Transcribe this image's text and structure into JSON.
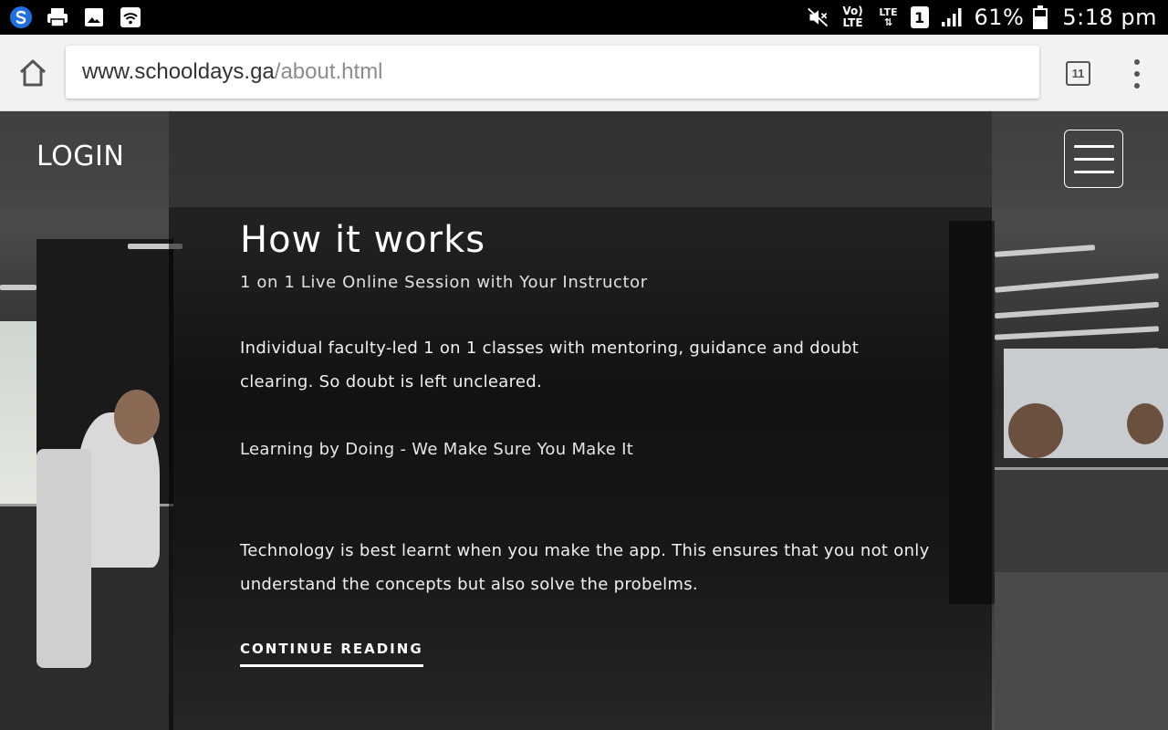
{
  "status_bar": {
    "battery_percent": "61%",
    "time": "5:18 pm",
    "network_label": "LTE",
    "volte_label": "Vo) LTE",
    "sim_slot": "1",
    "icons": [
      "s-app-icon",
      "printer-icon",
      "image-icon",
      "wifi-hotspot-icon",
      "mute-icon",
      "volte-icon",
      "lte-data-icon",
      "sim-icon",
      "signal-icon",
      "battery-icon"
    ]
  },
  "browser": {
    "url_domain": "www.schooldays.ga",
    "url_path": "/about.html",
    "tab_count": "11"
  },
  "site": {
    "login_label": "LOGIN",
    "section_title": "How it works",
    "subtitle": "1 on 1 Live Online Session with Your Instructor",
    "paragraph1": "Individual faculty-led 1 on 1 classes with mentoring, guidance and doubt clearing. So doubt is left uncleared.",
    "paragraph2": "Learning by Doing - We Make Sure You Make It",
    "paragraph3": "Technology is best learnt when you make the app. This ensures that you not only understand the concepts but also solve the probelms.",
    "continue_label": "CONTINUE READING"
  },
  "colors": {
    "status_bar_bg": "#000000",
    "toolbar_bg": "#f2f2f2",
    "url_path_color": "#8c8c8c",
    "overlay": "rgba(0,0,0,0.55)"
  }
}
